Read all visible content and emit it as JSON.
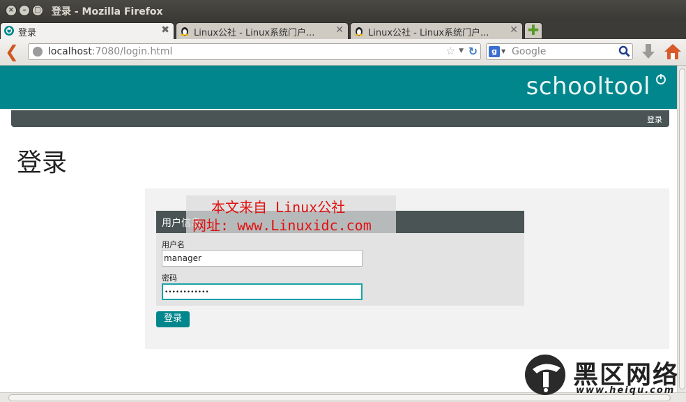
{
  "window": {
    "title": "登录 - Mozilla Firefox"
  },
  "tabs": [
    {
      "label": "登录",
      "active": true
    },
    {
      "label": "Linux公社 - Linux系统门户...",
      "active": false
    },
    {
      "label": "Linux公社 - Linux系统门户...",
      "active": false
    }
  ],
  "toolbar": {
    "url_host": "localhost",
    "url_rest": ":7080/login.html",
    "search_placeholder": "Google",
    "search_engine_icon": "g"
  },
  "site": {
    "brand": "schooltool",
    "menu_login": "登录",
    "page_title": "登录",
    "brand_color": "#00868c"
  },
  "form": {
    "legend": "用户信息",
    "username_label": "用户名",
    "username_value": "manager",
    "password_label": "密码",
    "password_value": "••••••••••••",
    "submit_label": "登录"
  },
  "watermark": {
    "line1": "本文来自 Linux公社",
    "line2": "网址: www.Linuxidc.com"
  },
  "corner_logo": {
    "cn": "黑区网络",
    "url": "www.heiqu.com"
  }
}
